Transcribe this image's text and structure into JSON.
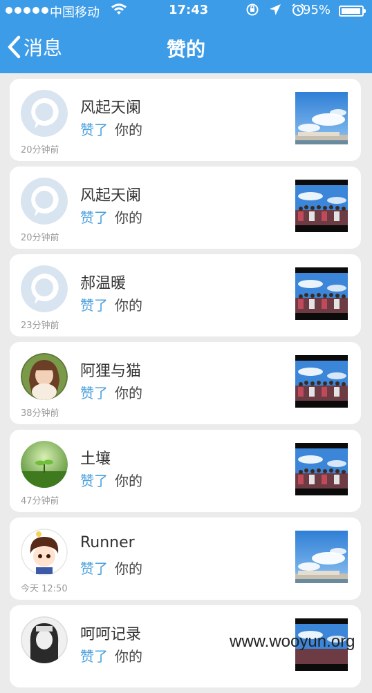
{
  "status_bar": {
    "carrier": "中国移动",
    "time": "17:43",
    "battery": "95%"
  },
  "nav": {
    "back_label": "消息",
    "title": "赞的"
  },
  "list": {
    "items": [
      {
        "name": "风起天阑",
        "liked": "赞了",
        "target": "你的",
        "time": "20分钟前",
        "avatar": "default-avatar",
        "thumb": "sky-photo"
      },
      {
        "name": "风起天阑",
        "liked": "赞了",
        "target": "你的",
        "time": "20分钟前",
        "avatar": "default-avatar",
        "thumb": "group-photo"
      },
      {
        "name": "郝温暖",
        "liked": "赞了",
        "target": "你的",
        "time": "23分钟前",
        "avatar": "default-avatar",
        "thumb": "group-photo"
      },
      {
        "name": "阿狸与猫",
        "liked": "赞了",
        "target": "你的",
        "time": "38分钟前",
        "avatar": "girl-photo",
        "thumb": "group-photo"
      },
      {
        "name": "土壤",
        "liked": "赞了",
        "target": "你的",
        "time": "47分钟前",
        "avatar": "sprout-photo",
        "thumb": "group-photo"
      },
      {
        "name": "Runner",
        "liked": "赞了",
        "target": "你的",
        "time": "今天 12:50",
        "avatar": "cartoon-boy",
        "thumb": "sky-photo"
      },
      {
        "name": "呵呵记录",
        "liked": "赞了",
        "target": "你的",
        "time": "",
        "avatar": "bw-portrait",
        "thumb": "group-photo"
      }
    ]
  },
  "watermark": "www.wooyun.org",
  "colors": {
    "header": "#3d9ce8",
    "liked_text": "#4a9fdc",
    "background": "#ebebeb"
  }
}
